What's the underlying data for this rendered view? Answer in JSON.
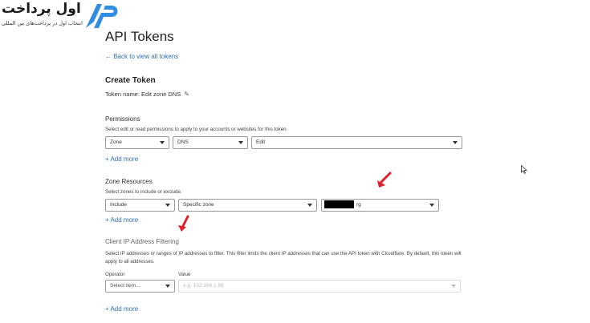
{
  "logo": {
    "title": "اول پرداخت",
    "subtitle": "انتخاب اول در پرداخت‌های بین المللی",
    "mark_text": "AP"
  },
  "page": {
    "title": "API Tokens",
    "back_link": "← Back to view all tokens"
  },
  "create": {
    "heading": "Create Token",
    "token_name": "Token name: Edit zone DNS"
  },
  "permissions": {
    "heading": "Permissions",
    "description": "Select edit or read permissions to apply to your accounts or websites for this token.",
    "selects": [
      "Zone",
      "DNS",
      "Edit"
    ],
    "add_more": "+ Add more"
  },
  "zone_resources": {
    "heading": "Zone Resources",
    "description": "Select zones to include or exclude.",
    "selects": [
      "Include",
      "Specific zone",
      "rg"
    ],
    "add_more": "+ Add more"
  },
  "ip_filtering": {
    "heading": "Client IP Address Filtering",
    "description": "Select IP addresses or ranges of IP addresses to filter. This filter limits the client IP addresses that can use the API token with Cloudflare. By default, this token will apply to all addresses.",
    "operator_label": "Operator",
    "value_label": "Value",
    "operator_placeholder": "Select item...",
    "value_placeholder": "e.g. 192.168.1.88",
    "add_more": "+ Add more"
  },
  "colors": {
    "link": "#2f6fb5",
    "arrow": "#e0202a",
    "logo_blue": "#2f8de4"
  }
}
